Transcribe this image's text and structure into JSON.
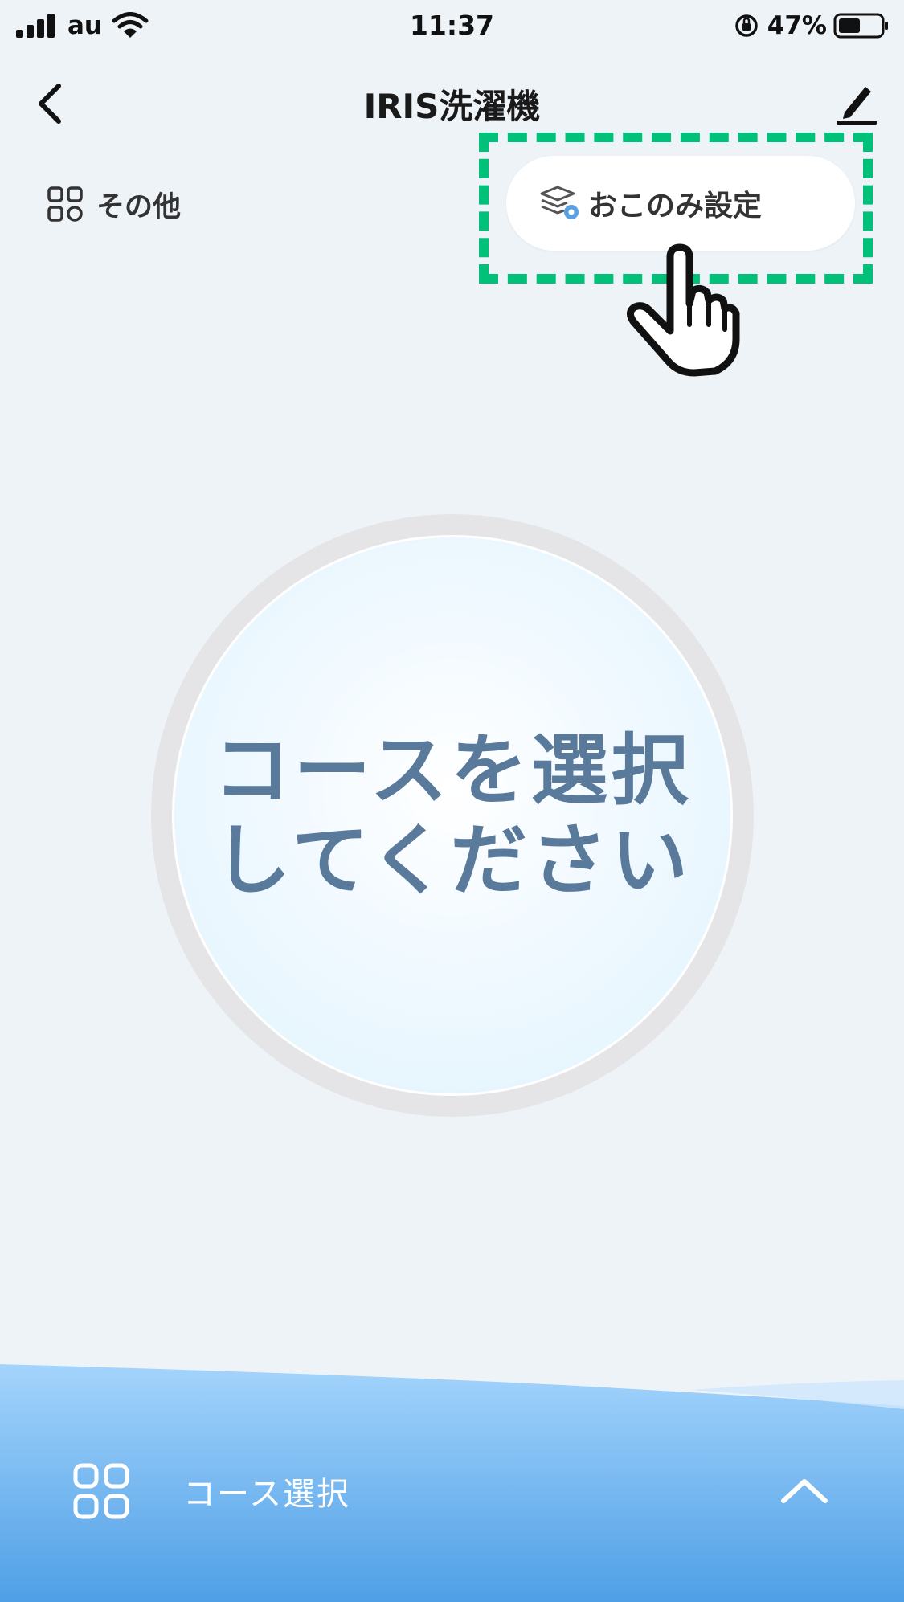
{
  "status_bar": {
    "carrier": "au",
    "time": "11:37",
    "battery_percent": "47%"
  },
  "nav": {
    "title": "IRIS洗濯機"
  },
  "top_row": {
    "other_label": "その他",
    "preference_label": "おこのみ設定"
  },
  "main": {
    "course_prompt_line1": "コースを選択",
    "course_prompt_line2": "してください"
  },
  "bottom_bar": {
    "course_select_label": "コース選択"
  },
  "colors": {
    "highlight": "#00c07a",
    "prompt_text": "#5a7a9c",
    "bottom_gradient_top": "#9fd2fb",
    "bottom_gradient_bottom": "#4f9fe6"
  },
  "icons": {
    "back": "chevron-left-icon",
    "edit": "pencil-icon",
    "other": "grid-icon",
    "preference": "layers-settings-icon",
    "course_select": "grid-icon",
    "expand": "chevron-up-icon",
    "pointer": "hand-pointer-icon"
  }
}
